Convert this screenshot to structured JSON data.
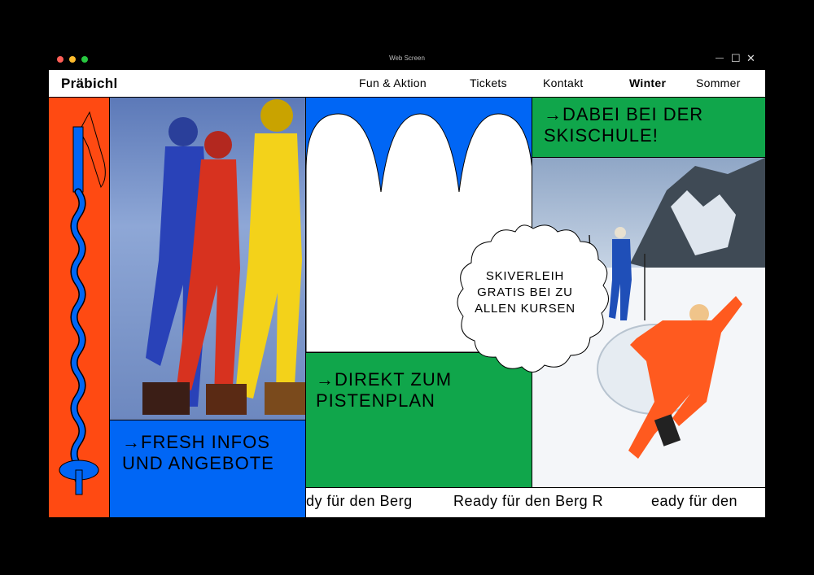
{
  "window": {
    "title": "Web Screen",
    "dot_colors": [
      "#ff5f57",
      "#febc2e",
      "#28c840"
    ],
    "controls": {
      "minimize": "—",
      "maximize": "☐",
      "close": "✕"
    }
  },
  "nav": {
    "logo": "Präbichl",
    "items": [
      {
        "label": "Fun & Aktion",
        "active": false
      },
      {
        "label": "Tickets",
        "active": false
      },
      {
        "label": "Kontakt",
        "active": false
      },
      {
        "label": "Winter",
        "active": true
      },
      {
        "label": "Sommer",
        "active": false
      }
    ]
  },
  "colors": {
    "orange": "#ff4a12",
    "blue": "#0066f5",
    "green": "#10a64b",
    "black": "#000000",
    "white": "#ffffff"
  },
  "ctas": {
    "fresh": "→FRESH INFOS UND ANGEBOTE",
    "pistenplan": "→DIREKT ZUM PISTENPLAN",
    "skischule": "→DABEI BEI DER SKISCHULE!"
  },
  "cloud_badge": "SKIVERLEIH GRATIS BEI ZU ALLEN KURSEN",
  "ticker": [
    "dy für den Berg",
    "Ready für den Berg R",
    "eady für den"
  ],
  "icons": {
    "ski_pole": "ski-pole-icon"
  }
}
